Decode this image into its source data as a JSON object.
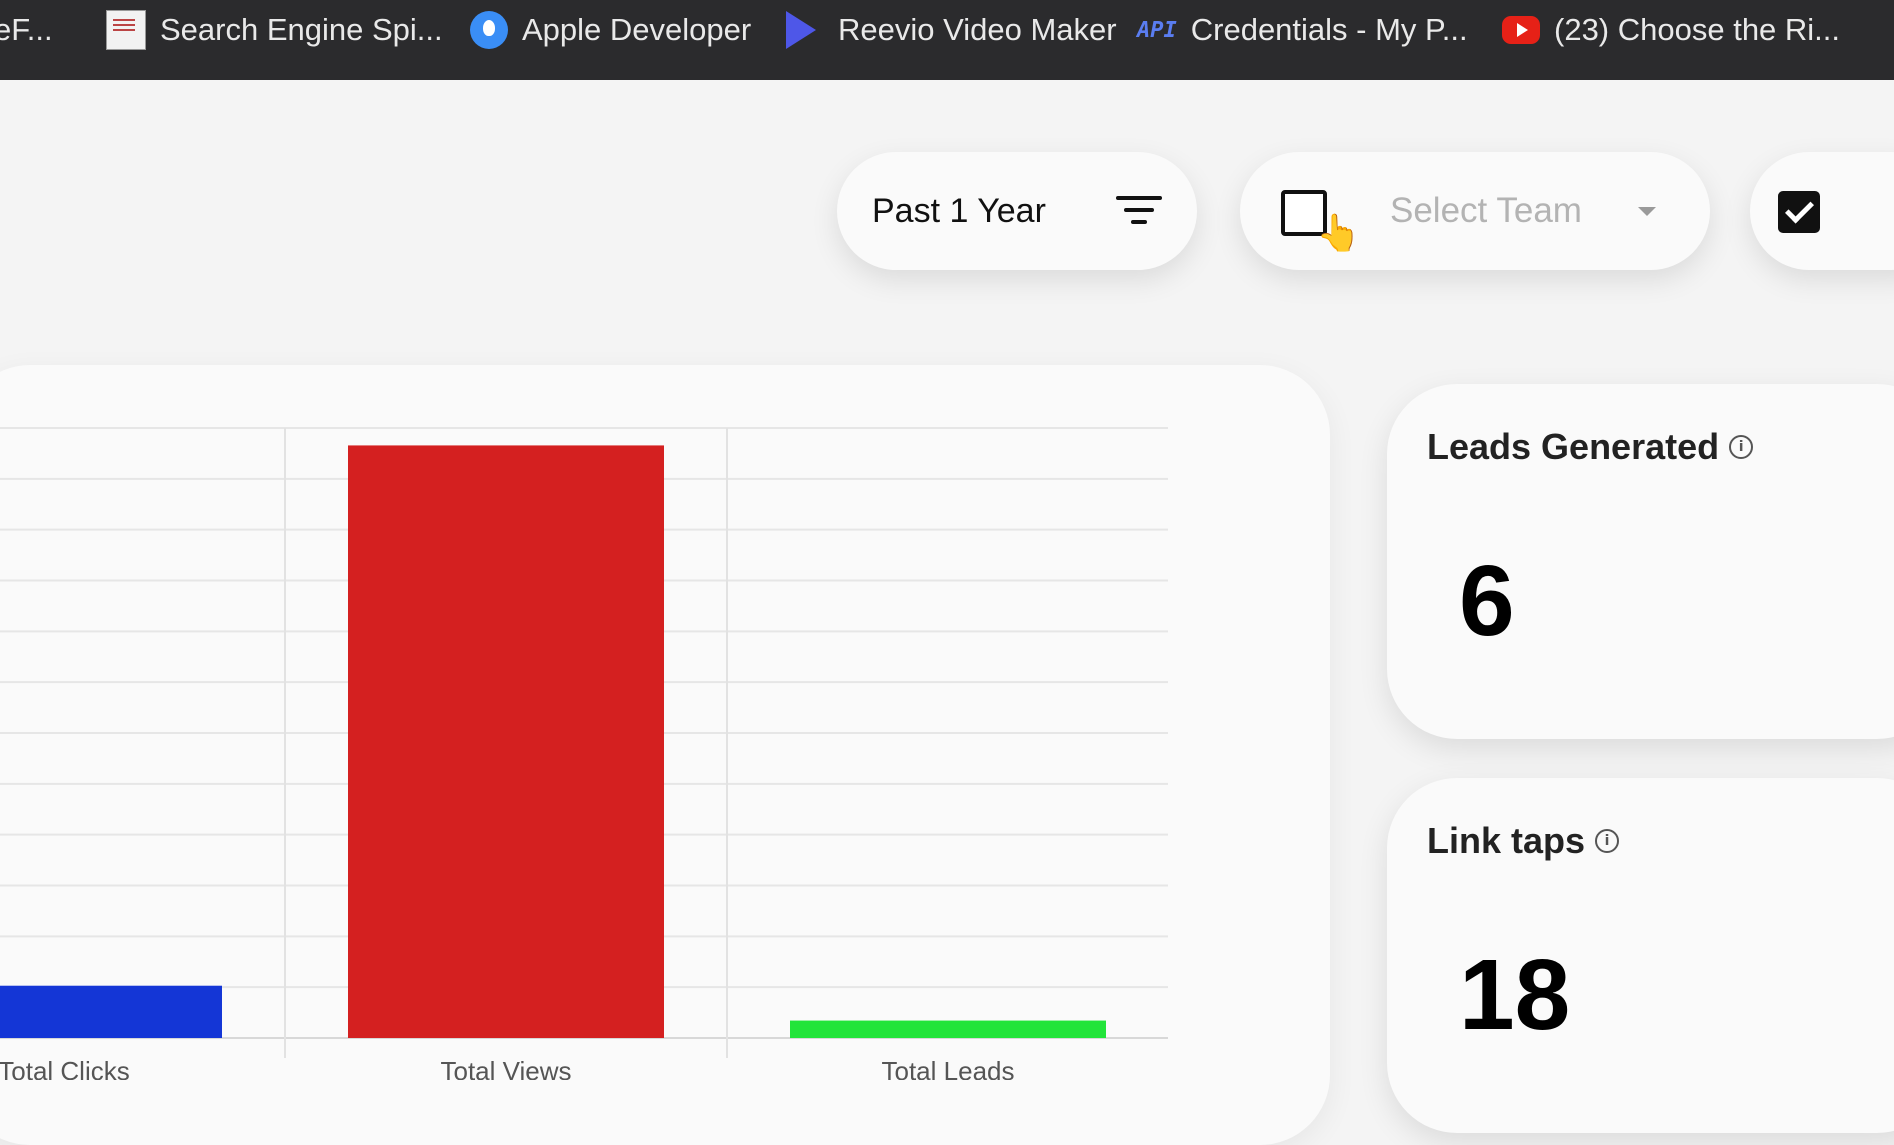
{
  "bookmarks": [
    {
      "label": "eF...",
      "icon": "none"
    },
    {
      "label": "Search Engine Spi...",
      "icon": "document-thumbnail-icon"
    },
    {
      "label": "Apple Developer",
      "icon": "apple-icon"
    },
    {
      "label": "Reevio Video Maker",
      "icon": "play-icon"
    },
    {
      "label": "Credentials - My P...",
      "icon": "api-icon"
    },
    {
      "label": "(23) Choose the Ri...",
      "icon": "youtube-icon"
    }
  ],
  "filters": {
    "period_label": "Past 1 Year",
    "team_placeholder": "Select Team"
  },
  "chart_data": {
    "type": "bar",
    "categories": [
      "Total Clicks",
      "Total Views",
      "Total Leads"
    ],
    "values": [
      18,
      204,
      6
    ],
    "colors": [
      "#1436d6",
      "#d42020",
      "#22e43a"
    ],
    "ylim": [
      0,
      210
    ],
    "grid": true
  },
  "stats": {
    "leads": {
      "title": "Leads Generated",
      "value": "6"
    },
    "links": {
      "title": "Link taps",
      "value": "18"
    }
  }
}
